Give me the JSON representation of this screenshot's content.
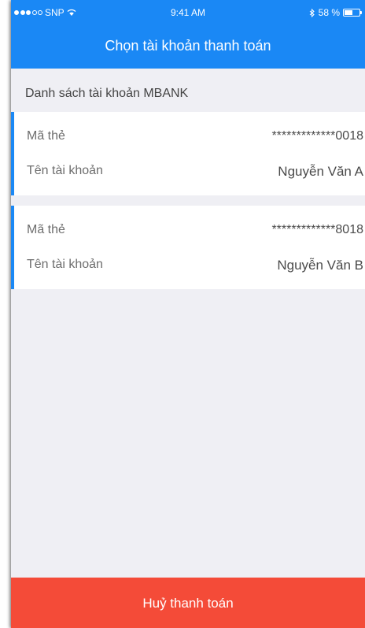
{
  "status_bar": {
    "carrier": "SNP",
    "time": "9:41 AM",
    "battery": "58 %",
    "battery_level": 0.58,
    "signal_bars": 3,
    "signal_total": 5,
    "icons": [
      "wifi-icon",
      "bluetooth-icon",
      "battery-icon"
    ]
  },
  "header": {
    "title": "Chọn tài khoản thanh toán"
  },
  "list": {
    "section_label": "Danh sách tài khoản MBANK",
    "accounts": [
      {
        "card_label": "Mã thẻ",
        "card_value": "*************0018",
        "name_label": "Tên tài khoản",
        "name_value": "Nguyễn Văn A"
      },
      {
        "card_label": "Mã thẻ",
        "card_value": "*************8018",
        "name_label": "Tên tài khoản",
        "name_value": "Nguyễn Văn B"
      }
    ]
  },
  "footer": {
    "cancel_label": "Huỷ thanh toán"
  },
  "colors": {
    "header_blue": "#1a88f5",
    "cancel_red": "#f44b38",
    "background": "#efeff4"
  }
}
